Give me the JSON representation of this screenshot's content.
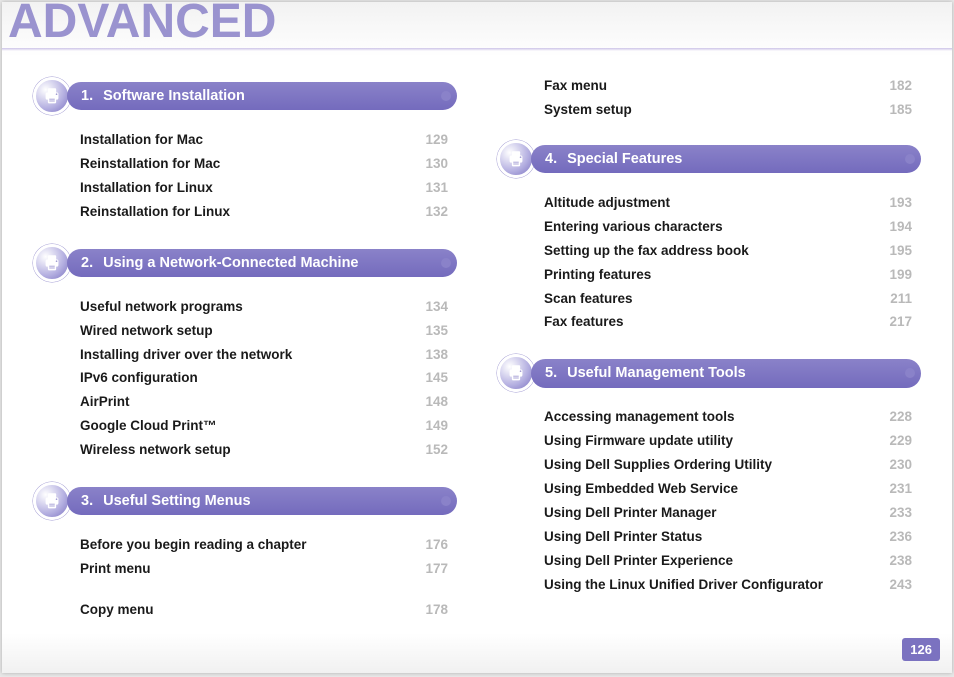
{
  "title": "ADVANCED",
  "page_number": "126",
  "sections": [
    {
      "num": "1.",
      "label": "Software Installation",
      "cont_from": 0,
      "entries": [
        {
          "t": "Installation for Mac",
          "p": "129"
        },
        {
          "t": "Reinstallation for Mac",
          "p": "130"
        },
        {
          "t": "Installation for Linux",
          "p": "131"
        },
        {
          "t": "Reinstallation for Linux",
          "p": "132"
        }
      ]
    },
    {
      "num": "2.",
      "label": "Using a Network-Connected Machine",
      "cont_from": 0,
      "entries": [
        {
          "t": "Useful network programs",
          "p": "134"
        },
        {
          "t": "Wired network setup",
          "p": "135"
        },
        {
          "t": "Installing driver over the network",
          "p": "138"
        },
        {
          "t": "IPv6 configuration",
          "p": "145"
        },
        {
          "t": "AirPrint",
          "p": "148"
        },
        {
          "t": "Google Cloud Print™",
          "p": "149"
        },
        {
          "t": "Wireless network setup",
          "p": "152"
        }
      ]
    },
    {
      "num": "3.",
      "label": "Useful Setting Menus",
      "cont_from": 2,
      "entries": [
        {
          "t": "Before you begin reading a chapter",
          "p": "176"
        },
        {
          "t": "Print menu",
          "p": "177"
        },
        {
          "t": "Copy menu",
          "p": "178"
        },
        {
          "t": "Fax menu",
          "p": "182"
        },
        {
          "t": "System setup",
          "p": "185"
        }
      ]
    },
    {
      "num": "4.",
      "label": "Special Features",
      "cont_from": 0,
      "entries": [
        {
          "t": "Altitude adjustment",
          "p": "193"
        },
        {
          "t": "Entering various characters",
          "p": "194"
        },
        {
          "t": "Setting up the fax address book",
          "p": "195"
        },
        {
          "t": "Printing features",
          "p": "199"
        },
        {
          "t": "Scan features",
          "p": "211"
        },
        {
          "t": "Fax features",
          "p": "217"
        }
      ]
    },
    {
      "num": "5.",
      "label": "Useful Management Tools",
      "cont_from": 0,
      "entries": [
        {
          "t": "Accessing management tools",
          "p": "228"
        },
        {
          "t": "Using Firmware update utility",
          "p": "229"
        },
        {
          "t": "Using Dell Supplies Ordering Utility",
          "p": "230"
        },
        {
          "t": "Using Embedded Web Service",
          "p": "231"
        },
        {
          "t": "Using Dell Printer Manager",
          "p": "233"
        },
        {
          "t": "Using Dell Printer Status",
          "p": "236"
        },
        {
          "t": "Using Dell Printer Experience",
          "p": "238"
        },
        {
          "t": "Using the Linux Unified Driver Configurator",
          "p": "243"
        }
      ]
    }
  ]
}
